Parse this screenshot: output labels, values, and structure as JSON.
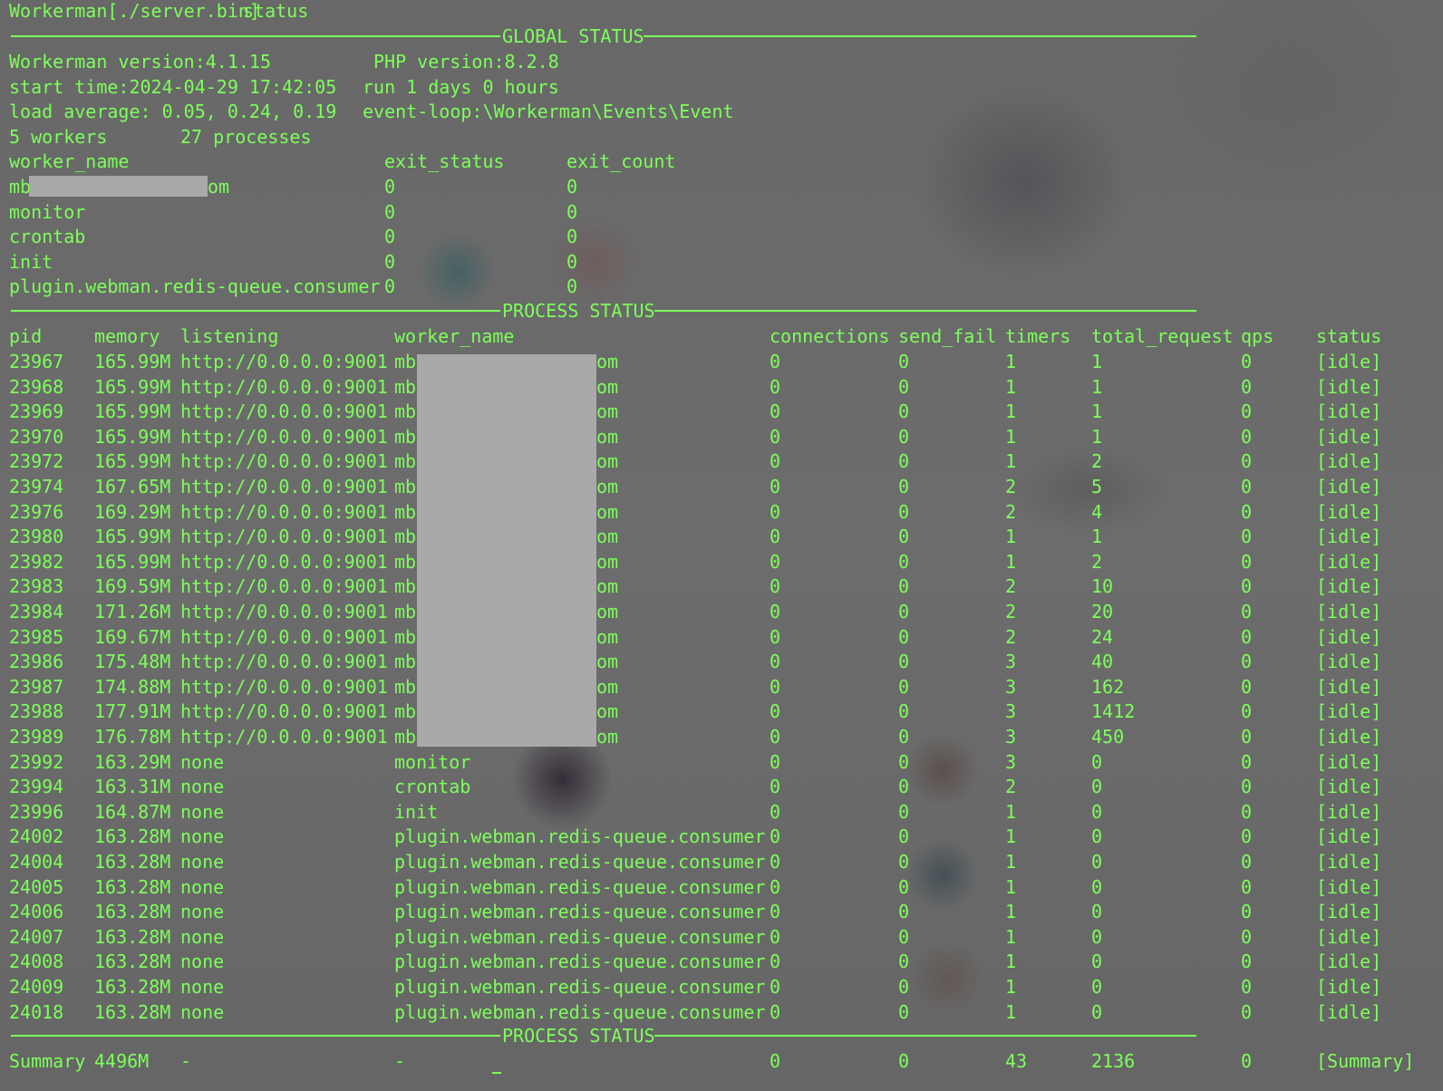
{
  "prompt": {
    "app": "Workerman[./server.bin]",
    "command": "status"
  },
  "global_status": {
    "title": "GLOBAL STATUS",
    "workerman_version": "Workerman version:4.1.15",
    "php_version": "PHP version:8.2.8",
    "start_time": "start time:2024-04-29 17:42:05",
    "run_time": "run 1 days 0 hours",
    "load_average": "load average: 0.05, 0.24, 0.19",
    "event_loop": "event-loop:\\Workerman\\Events\\Event",
    "workers": "5 workers",
    "processes": "27 processes",
    "columns": [
      "worker_name",
      "exit_status",
      "exit_count"
    ],
    "rows": [
      {
        "worker_name": "mb",
        "suffix": "om",
        "redacted": true,
        "exit_status": "0",
        "exit_count": "0"
      },
      {
        "worker_name": "monitor",
        "suffix": "",
        "redacted": false,
        "exit_status": "0",
        "exit_count": "0"
      },
      {
        "worker_name": "crontab",
        "suffix": "",
        "redacted": false,
        "exit_status": "0",
        "exit_count": "0"
      },
      {
        "worker_name": "init",
        "suffix": "",
        "redacted": false,
        "exit_status": "0",
        "exit_count": "0"
      },
      {
        "worker_name": "plugin.webman.redis-queue.consumer",
        "suffix": "",
        "redacted": false,
        "exit_status": "0",
        "exit_count": "0"
      }
    ]
  },
  "process_status": {
    "title": "PROCESS STATUS",
    "columns": [
      "pid",
      "memory",
      "listening",
      "worker_name",
      "connections",
      "send_fail",
      "timers",
      "total_request",
      "qps",
      "status"
    ],
    "rows": [
      {
        "pid": "23967",
        "memory": "165.99M",
        "listening": "http://0.0.0.0:9001",
        "worker_name": "mb",
        "suffix": "om",
        "connections": "0",
        "send_fail": "0",
        "timers": "1",
        "total_request": "1",
        "qps": "0",
        "status": "[idle]"
      },
      {
        "pid": "23968",
        "memory": "165.99M",
        "listening": "http://0.0.0.0:9001",
        "worker_name": "mb",
        "suffix": "om",
        "connections": "0",
        "send_fail": "0",
        "timers": "1",
        "total_request": "1",
        "qps": "0",
        "status": "[idle]"
      },
      {
        "pid": "23969",
        "memory": "165.99M",
        "listening": "http://0.0.0.0:9001",
        "worker_name": "mb",
        "suffix": "om",
        "connections": "0",
        "send_fail": "0",
        "timers": "1",
        "total_request": "1",
        "qps": "0",
        "status": "[idle]"
      },
      {
        "pid": "23970",
        "memory": "165.99M",
        "listening": "http://0.0.0.0:9001",
        "worker_name": "mb",
        "suffix": "om",
        "connections": "0",
        "send_fail": "0",
        "timers": "1",
        "total_request": "1",
        "qps": "0",
        "status": "[idle]"
      },
      {
        "pid": "23972",
        "memory": "165.99M",
        "listening": "http://0.0.0.0:9001",
        "worker_name": "mb",
        "suffix": "om",
        "connections": "0",
        "send_fail": "0",
        "timers": "1",
        "total_request": "2",
        "qps": "0",
        "status": "[idle]"
      },
      {
        "pid": "23974",
        "memory": "167.65M",
        "listening": "http://0.0.0.0:9001",
        "worker_name": "mb",
        "suffix": "om",
        "connections": "0",
        "send_fail": "0",
        "timers": "2",
        "total_request": "5",
        "qps": "0",
        "status": "[idle]"
      },
      {
        "pid": "23976",
        "memory": "169.29M",
        "listening": "http://0.0.0.0:9001",
        "worker_name": "mb",
        "suffix": "om",
        "connections": "0",
        "send_fail": "0",
        "timers": "2",
        "total_request": "4",
        "qps": "0",
        "status": "[idle]"
      },
      {
        "pid": "23980",
        "memory": "165.99M",
        "listening": "http://0.0.0.0:9001",
        "worker_name": "mb",
        "suffix": "om",
        "connections": "0",
        "send_fail": "0",
        "timers": "1",
        "total_request": "1",
        "qps": "0",
        "status": "[idle]"
      },
      {
        "pid": "23982",
        "memory": "165.99M",
        "listening": "http://0.0.0.0:9001",
        "worker_name": "mb",
        "suffix": "om",
        "connections": "0",
        "send_fail": "0",
        "timers": "1",
        "total_request": "2",
        "qps": "0",
        "status": "[idle]"
      },
      {
        "pid": "23983",
        "memory": "169.59M",
        "listening": "http://0.0.0.0:9001",
        "worker_name": "mb",
        "suffix": "om",
        "connections": "0",
        "send_fail": "0",
        "timers": "2",
        "total_request": "10",
        "qps": "0",
        "status": "[idle]"
      },
      {
        "pid": "23984",
        "memory": "171.26M",
        "listening": "http://0.0.0.0:9001",
        "worker_name": "mb",
        "suffix": "om",
        "connections": "0",
        "send_fail": "0",
        "timers": "2",
        "total_request": "20",
        "qps": "0",
        "status": "[idle]"
      },
      {
        "pid": "23985",
        "memory": "169.67M",
        "listening": "http://0.0.0.0:9001",
        "worker_name": "mb",
        "suffix": "om",
        "connections": "0",
        "send_fail": "0",
        "timers": "2",
        "total_request": "24",
        "qps": "0",
        "status": "[idle]"
      },
      {
        "pid": "23986",
        "memory": "175.48M",
        "listening": "http://0.0.0.0:9001",
        "worker_name": "mb",
        "suffix": "om",
        "connections": "0",
        "send_fail": "0",
        "timers": "3",
        "total_request": "40",
        "qps": "0",
        "status": "[idle]"
      },
      {
        "pid": "23987",
        "memory": "174.88M",
        "listening": "http://0.0.0.0:9001",
        "worker_name": "mb",
        "suffix": "om",
        "connections": "0",
        "send_fail": "0",
        "timers": "3",
        "total_request": "162",
        "qps": "0",
        "status": "[idle]"
      },
      {
        "pid": "23988",
        "memory": "177.91M",
        "listening": "http://0.0.0.0:9001",
        "worker_name": "mb",
        "suffix": "om",
        "connections": "0",
        "send_fail": "0",
        "timers": "3",
        "total_request": "1412",
        "qps": "0",
        "status": "[idle]"
      },
      {
        "pid": "23989",
        "memory": "176.78M",
        "listening": "http://0.0.0.0:9001",
        "worker_name": "mb",
        "suffix": "om",
        "connections": "0",
        "send_fail": "0",
        "timers": "3",
        "total_request": "450",
        "qps": "0",
        "status": "[idle]"
      },
      {
        "pid": "23992",
        "memory": "163.29M",
        "listening": "none",
        "worker_name": "monitor",
        "suffix": "",
        "connections": "0",
        "send_fail": "0",
        "timers": "3",
        "total_request": "0",
        "qps": "0",
        "status": "[idle]"
      },
      {
        "pid": "23994",
        "memory": "163.31M",
        "listening": "none",
        "worker_name": "crontab",
        "suffix": "",
        "connections": "0",
        "send_fail": "0",
        "timers": "2",
        "total_request": "0",
        "qps": "0",
        "status": "[idle]"
      },
      {
        "pid": "23996",
        "memory": "164.87M",
        "listening": "none",
        "worker_name": "init",
        "suffix": "",
        "connections": "0",
        "send_fail": "0",
        "timers": "1",
        "total_request": "0",
        "qps": "0",
        "status": "[idle]"
      },
      {
        "pid": "24002",
        "memory": "163.28M",
        "listening": "none",
        "worker_name": "plugin.webman.redis-queue.consumer",
        "suffix": "",
        "connections": "0",
        "send_fail": "0",
        "timers": "1",
        "total_request": "0",
        "qps": "0",
        "status": "[idle]"
      },
      {
        "pid": "24004",
        "memory": "163.28M",
        "listening": "none",
        "worker_name": "plugin.webman.redis-queue.consumer",
        "suffix": "",
        "connections": "0",
        "send_fail": "0",
        "timers": "1",
        "total_request": "0",
        "qps": "0",
        "status": "[idle]"
      },
      {
        "pid": "24005",
        "memory": "163.28M",
        "listening": "none",
        "worker_name": "plugin.webman.redis-queue.consumer",
        "suffix": "",
        "connections": "0",
        "send_fail": "0",
        "timers": "1",
        "total_request": "0",
        "qps": "0",
        "status": "[idle]"
      },
      {
        "pid": "24006",
        "memory": "163.28M",
        "listening": "none",
        "worker_name": "plugin.webman.redis-queue.consumer",
        "suffix": "",
        "connections": "0",
        "send_fail": "0",
        "timers": "1",
        "total_request": "0",
        "qps": "0",
        "status": "[idle]"
      },
      {
        "pid": "24007",
        "memory": "163.28M",
        "listening": "none",
        "worker_name": "plugin.webman.redis-queue.consumer",
        "suffix": "",
        "connections": "0",
        "send_fail": "0",
        "timers": "1",
        "total_request": "0",
        "qps": "0",
        "status": "[idle]"
      },
      {
        "pid": "24008",
        "memory": "163.28M",
        "listening": "none",
        "worker_name": "plugin.webman.redis-queue.consumer",
        "suffix": "",
        "connections": "0",
        "send_fail": "0",
        "timers": "1",
        "total_request": "0",
        "qps": "0",
        "status": "[idle]"
      },
      {
        "pid": "24009",
        "memory": "163.28M",
        "listening": "none",
        "worker_name": "plugin.webman.redis-queue.consumer",
        "suffix": "",
        "connections": "0",
        "send_fail": "0",
        "timers": "1",
        "total_request": "0",
        "qps": "0",
        "status": "[idle]"
      },
      {
        "pid": "24018",
        "memory": "163.28M",
        "listening": "none",
        "worker_name": "plugin.webman.redis-queue.consumer",
        "suffix": "",
        "connections": "0",
        "send_fail": "0",
        "timers": "1",
        "total_request": "0",
        "qps": "0",
        "status": "[idle]"
      }
    ]
  },
  "summary": {
    "title": "PROCESS STATUS",
    "pid": "Summary",
    "memory": "4496M",
    "listening": "-",
    "worker_name": "-",
    "connections": "0",
    "send_fail": "0",
    "timers": "43",
    "total_request": "2136",
    "qps": "0",
    "status": "[Summary]"
  },
  "colors": {
    "terminal_text": "#7dff5a",
    "terminal_background": "#6d6d6d",
    "redaction": "#a9a9a9"
  }
}
